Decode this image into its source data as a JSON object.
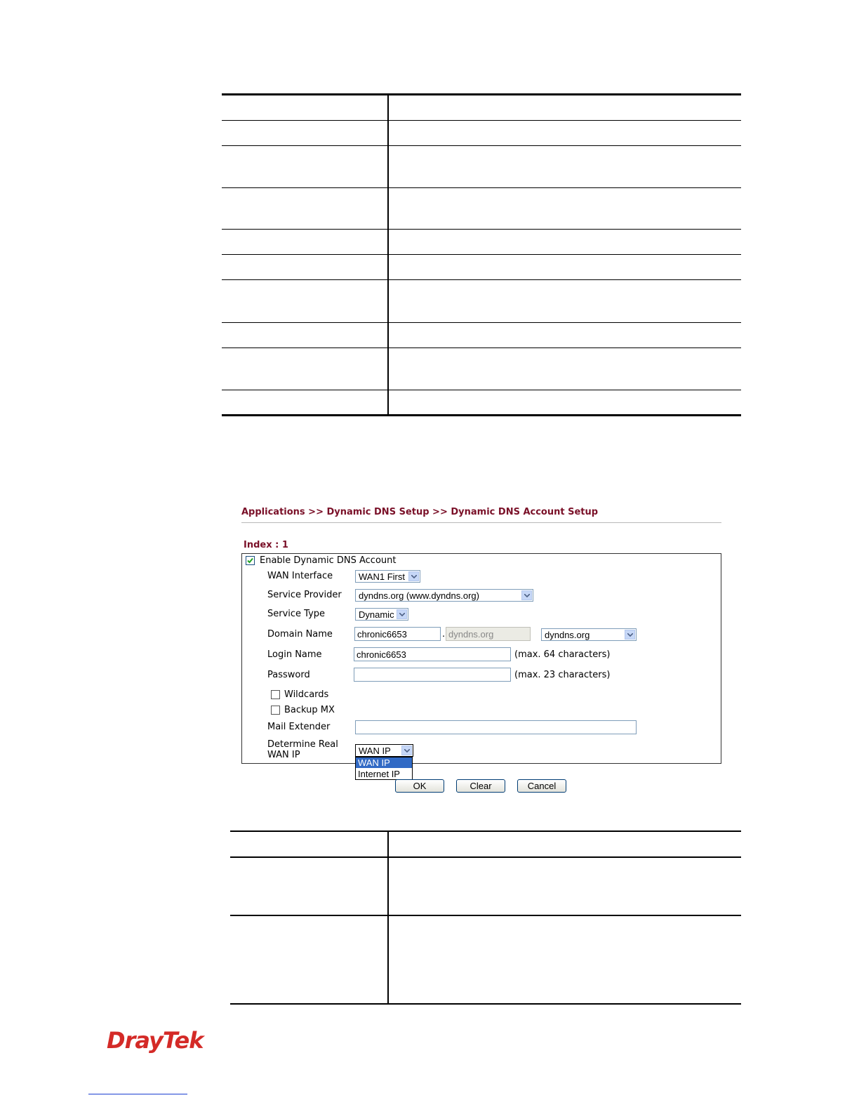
{
  "breadcrumb": "Applications >> Dynamic DNS Setup >> Dynamic DNS Account Setup",
  "index_label": "Index : 1",
  "form": {
    "enable_label": "Enable Dynamic DNS Account",
    "enable_checked": true,
    "wan_interface": {
      "label": "WAN Interface",
      "value": "WAN1 First"
    },
    "service_provider": {
      "label": "Service Provider",
      "value": "dyndns.org (www.dyndns.org)"
    },
    "service_type": {
      "label": "Service Type",
      "value": "Dynamic"
    },
    "domain_name": {
      "label": "Domain Name",
      "host": "chronic6653",
      "separator": ".",
      "domain": "dyndns.org",
      "domain_select": "dyndns.org"
    },
    "login_name": {
      "label": "Login Name",
      "value": "chronic6653",
      "hint": "(max. 64 characters)"
    },
    "password": {
      "label": "Password",
      "value": "",
      "hint": "(max. 23 characters)"
    },
    "wildcards": {
      "label": "Wildcards",
      "checked": false
    },
    "backup_mx": {
      "label": "Backup MX",
      "checked": false
    },
    "mail_extender": {
      "label": "Mail Extender",
      "value": ""
    },
    "determine_real_wan_ip": {
      "label_line1": "Determine Real",
      "label_line2": "WAN IP",
      "value": "WAN IP",
      "options": [
        "WAN IP",
        "Internet IP"
      ],
      "highlighted": "WAN IP"
    }
  },
  "buttons": {
    "ok": "OK",
    "clear": "Clear",
    "cancel": "Cancel"
  },
  "logo_text": "DrayTek",
  "colors": {
    "breadcrumb": "#7a1028",
    "logo": "#d42a27",
    "highlight": "#316ac5"
  }
}
